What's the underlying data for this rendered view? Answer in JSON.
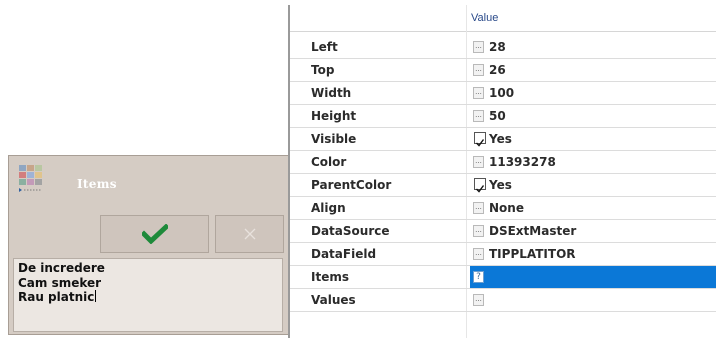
{
  "dialog": {
    "title": "Items",
    "ok_icon": "checkmark-icon",
    "cancel_icon": "close-icon",
    "accent_ok": "#1e8a3a",
    "memo_lines": [
      "De incredere",
      "Cam smeker",
      "Rau platnic"
    ]
  },
  "inspector": {
    "header_value": "Value",
    "properties": [
      {
        "name": "Left",
        "value": "28",
        "editor": "ellipsis"
      },
      {
        "name": "Top",
        "value": "26",
        "editor": "ellipsis"
      },
      {
        "name": "Width",
        "value": "100",
        "editor": "ellipsis"
      },
      {
        "name": "Height",
        "value": "50",
        "editor": "ellipsis"
      },
      {
        "name": "Visible",
        "value": "Yes",
        "editor": "checkbox",
        "checked": true
      },
      {
        "name": "Color",
        "value": "11393278",
        "editor": "ellipsis"
      },
      {
        "name": "ParentColor",
        "value": "Yes",
        "editor": "checkbox",
        "checked": true
      },
      {
        "name": "Align",
        "value": "None",
        "editor": "ellipsis"
      },
      {
        "name": "DataSource",
        "value": "DSExtMaster",
        "editor": "ellipsis"
      },
      {
        "name": "DataField",
        "value": "TIPPLATITOR",
        "editor": "ellipsis"
      },
      {
        "name": "Items",
        "value": "",
        "editor": "ellipsis",
        "selected": true,
        "button_glyph": "?"
      },
      {
        "name": "Values",
        "value": "",
        "editor": "ellipsis"
      }
    ],
    "selection_color": "#0b78d7"
  }
}
